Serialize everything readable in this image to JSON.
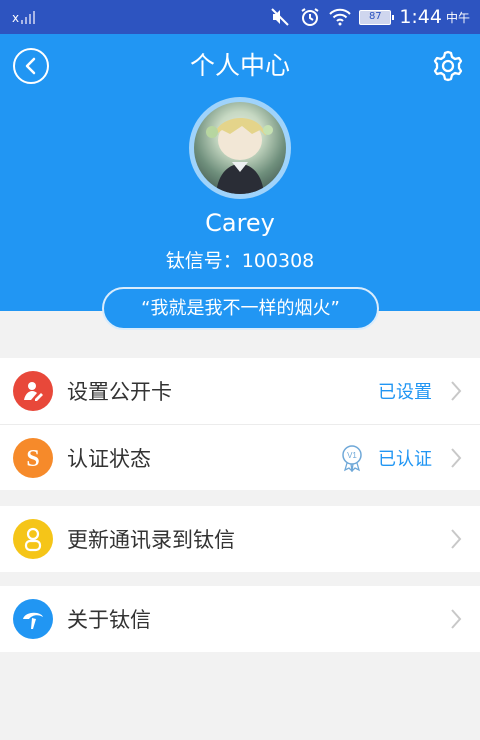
{
  "status_bar": {
    "signal_label": "x",
    "battery": "87",
    "time": "1:44",
    "ampm": "中午"
  },
  "header": {
    "title": "个人中心",
    "username": "Carey",
    "account_id": "钛信号：100308",
    "signature": "“我就是我不一样的烟火”"
  },
  "menu": [
    {
      "label": "设置公开卡",
      "value": "已设置",
      "icon": "person-card-icon",
      "icon_color": "#e8483a"
    },
    {
      "label": "认证状态",
      "value": "已认证",
      "badge": "V1",
      "icon": "s-certification-icon",
      "icon_color": "#f68a2a"
    },
    {
      "label": "更新通讯录到钛信",
      "value": "",
      "icon": "contact-person-icon",
      "icon_color": "#f5c518"
    },
    {
      "label": "关于钛信",
      "value": "",
      "icon": "about-logo-icon",
      "icon_color": "#2196f3"
    }
  ],
  "colors": {
    "status_bar": "#2d54c0",
    "header": "#2196f3",
    "accent": "#2196f3"
  }
}
